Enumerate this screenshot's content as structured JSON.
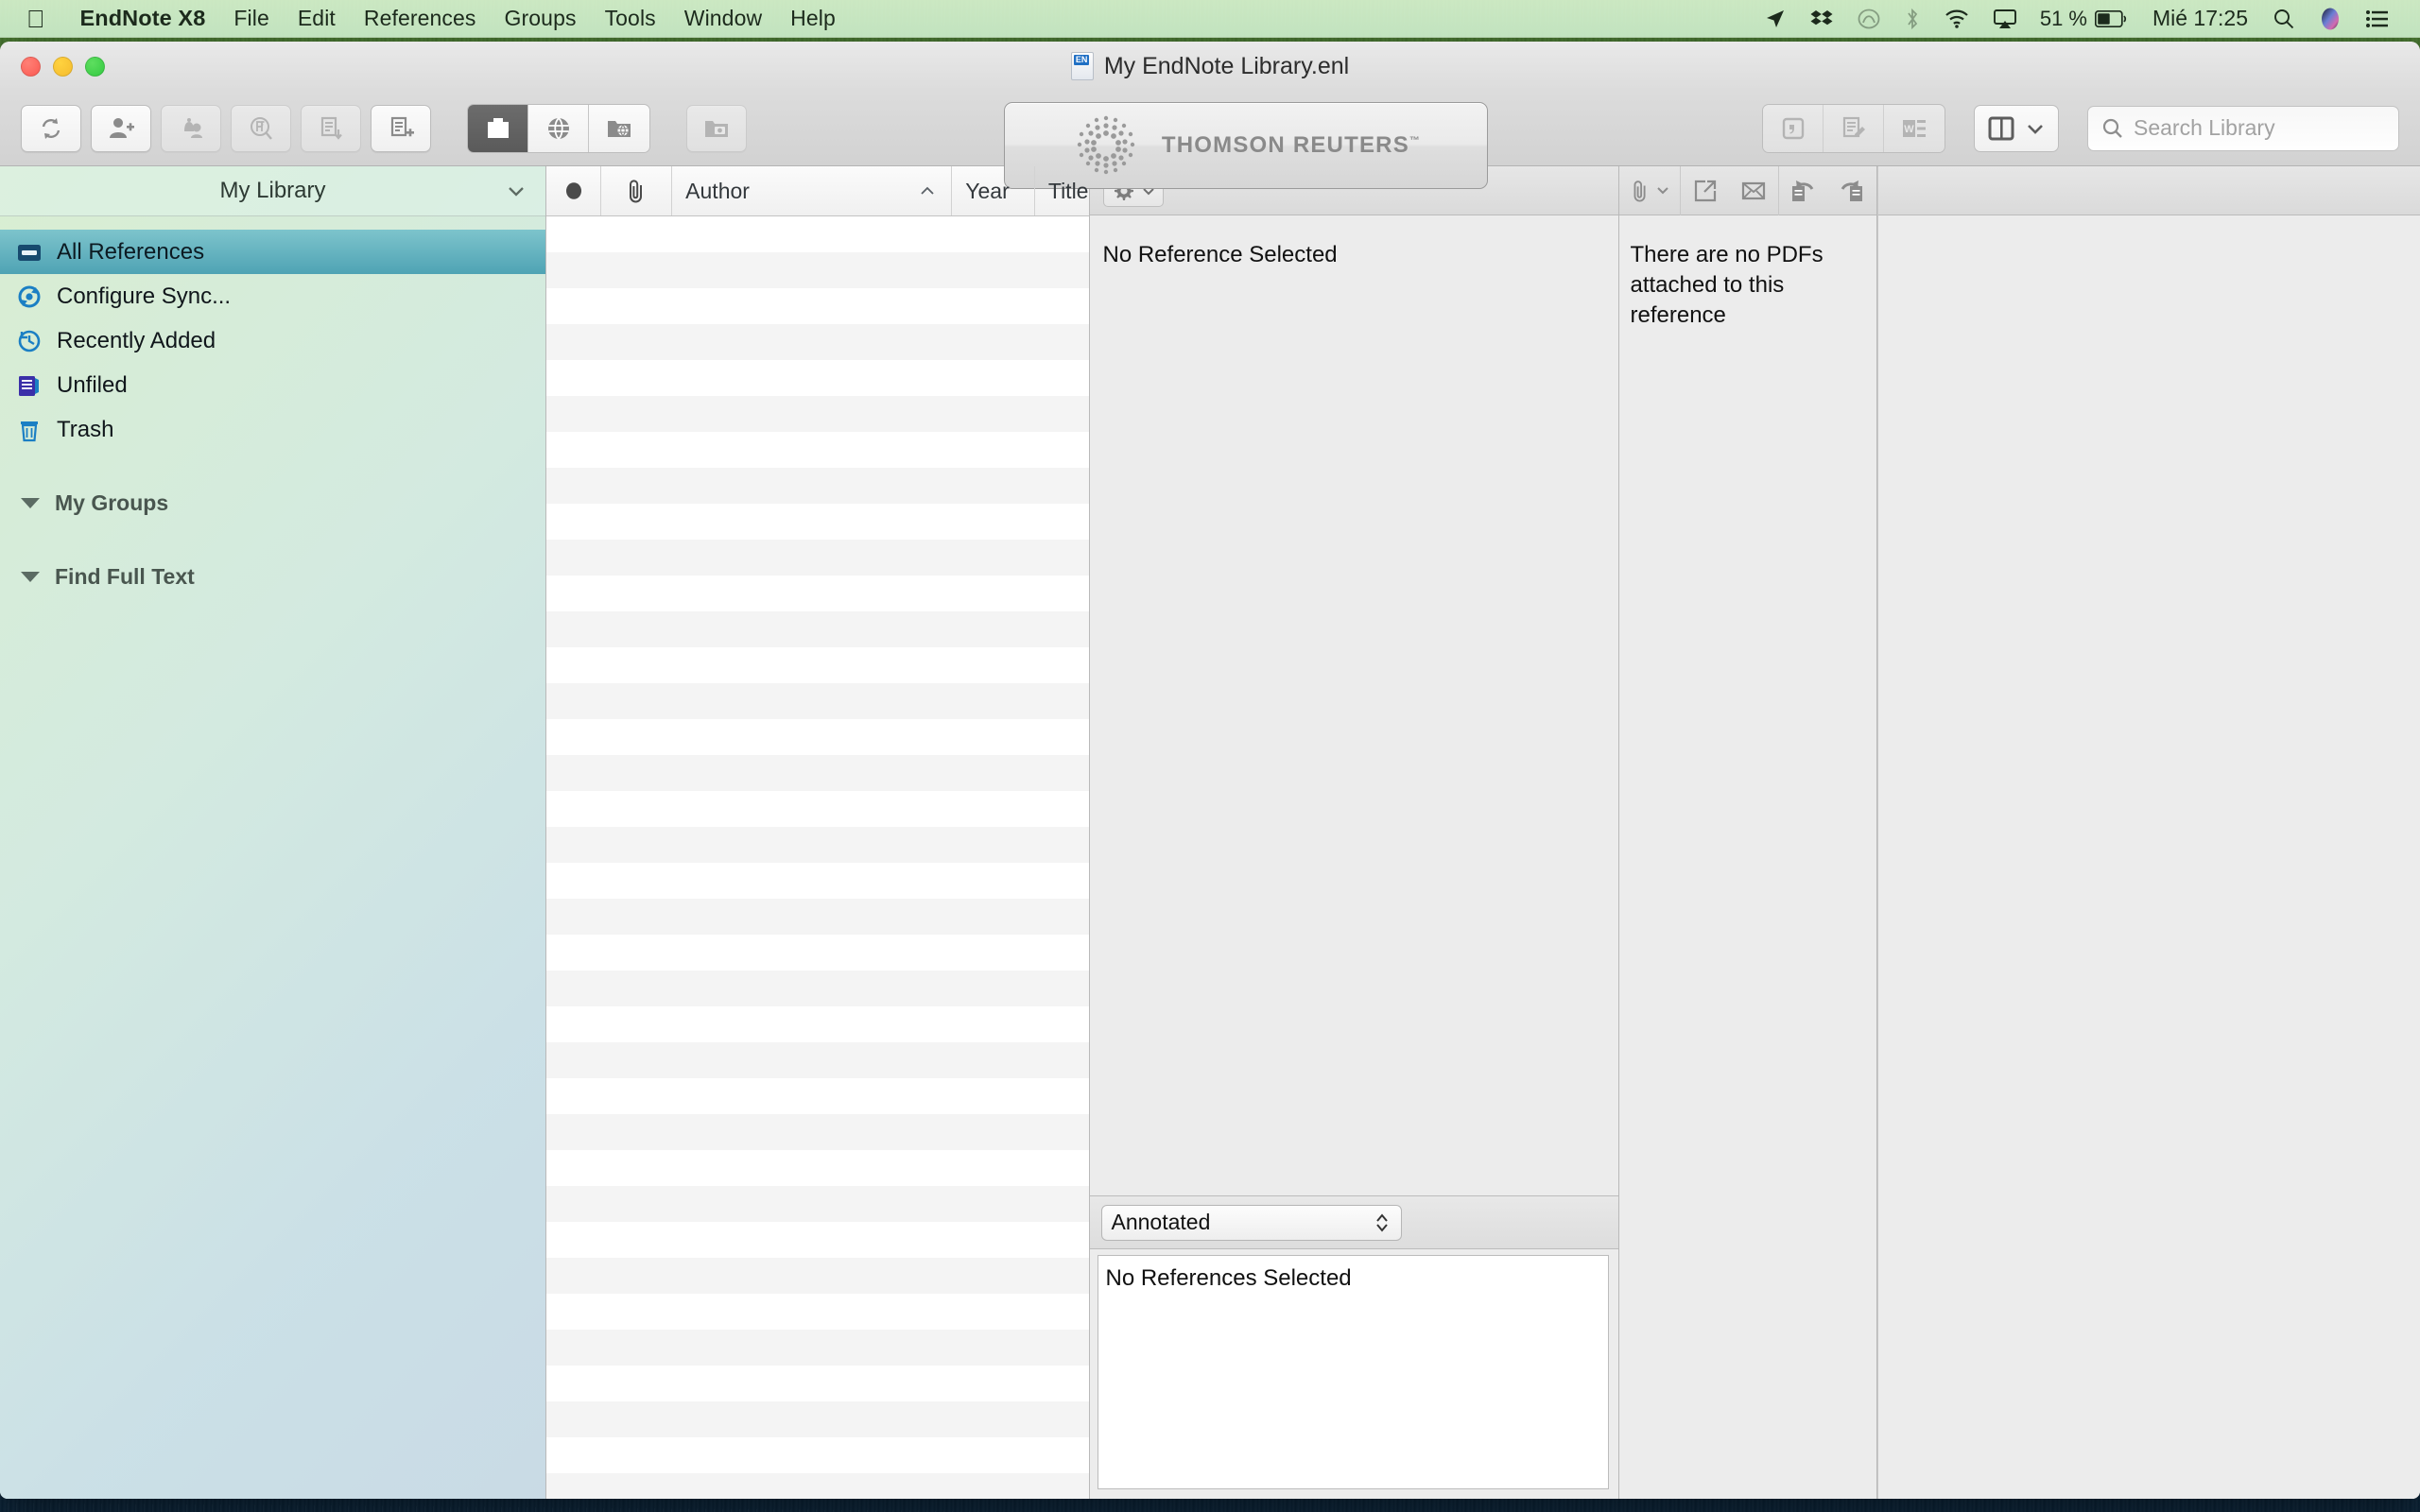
{
  "menubar": {
    "apple_icon": "apple-logo-icon",
    "items": [
      {
        "label": "EndNote X8",
        "bold": true
      },
      {
        "label": "File"
      },
      {
        "label": "Edit"
      },
      {
        "label": "References"
      },
      {
        "label": "Groups"
      },
      {
        "label": "Tools"
      },
      {
        "label": "Window"
      },
      {
        "label": "Help"
      }
    ],
    "status": {
      "icons": [
        "location-arrow-icon",
        "dropbox-icon",
        "creative-cloud-icon",
        "bluetooth-icon",
        "wifi-icon",
        "airplay-icon"
      ],
      "battery_percent": "51 %",
      "clock": "Mié 17:25",
      "trailing_icons": [
        "spotlight-search-icon",
        "siri-icon",
        "notification-center-icon"
      ]
    }
  },
  "window": {
    "title": "My EndNote Library.enl",
    "doc_icon": "endnote-document-icon"
  },
  "toolbar": {
    "buttons": [
      {
        "name": "sync-button",
        "icon": "sync-icon",
        "disabled": false
      },
      {
        "name": "share-library-button",
        "icon": "person-add-icon",
        "disabled": false
      },
      {
        "name": "activity-feed-button",
        "icon": "bell-person-icon",
        "disabled": true
      },
      {
        "name": "find-full-text-button",
        "icon": "pdf-search-icon",
        "disabled": true
      },
      {
        "name": "import-button",
        "icon": "document-import-icon",
        "disabled": true
      },
      {
        "name": "new-reference-button",
        "icon": "document-plus-icon",
        "disabled": false
      }
    ],
    "segmented": [
      {
        "name": "local-library-mode-button",
        "icon": "local-library-icon",
        "active": true
      },
      {
        "name": "online-search-mode-button",
        "icon": "globe-icon",
        "active": false
      },
      {
        "name": "integrated-mode-button",
        "icon": "folder-globe-icon",
        "active": false
      }
    ],
    "trailing_button": {
      "name": "sync-status-button",
      "icon": "folder-sync-icon",
      "disabled": true
    },
    "brand": {
      "name": "thomson-reuters-logo",
      "text": "THOMSON REUTERS",
      "trademark": "™"
    },
    "right_buttons": [
      {
        "name": "insert-citation-button",
        "icon": "quote-icon",
        "disabled": true
      },
      {
        "name": "format-bibliography-button",
        "icon": "document-pencil-icon",
        "disabled": true
      },
      {
        "name": "go-to-word-button",
        "icon": "microsoft-word-icon",
        "disabled": true
      }
    ],
    "view_button": {
      "name": "layout-view-button",
      "icon": "split-view-icon"
    },
    "accent_selected": "#5a5a5a"
  },
  "search": {
    "placeholder": "Search Library",
    "value": "",
    "icon": "magnifier-icon"
  },
  "sidebar": {
    "header": {
      "label": "My Library",
      "chevron": "chevron-down-icon"
    },
    "items": [
      {
        "label": "All References",
        "icon": "all-references-icon",
        "selected": true
      },
      {
        "label": "Configure Sync...",
        "icon": "configure-sync-icon",
        "selected": false
      },
      {
        "label": "Recently Added",
        "icon": "recently-added-clock-icon",
        "selected": false
      },
      {
        "label": "Unfiled",
        "icon": "unfiled-icon",
        "selected": false
      },
      {
        "label": "Trash",
        "icon": "trash-icon",
        "selected": false
      }
    ],
    "groups": [
      {
        "label": "My Groups",
        "expanded": true
      },
      {
        "label": "Find Full Text",
        "expanded": true
      }
    ],
    "selection_color": "#4fa3b4"
  },
  "reference_list": {
    "columns": [
      {
        "label": "",
        "name": "read-status-column",
        "icon": "filled-circle-icon"
      },
      {
        "label": "",
        "name": "attachment-column",
        "icon": "paperclip-icon"
      },
      {
        "label": "Author",
        "name": "author-column",
        "sorted": "ascending",
        "sort_icon": "caret-up-icon"
      },
      {
        "label": "Year",
        "name": "year-column"
      },
      {
        "label": "Title",
        "name": "title-column"
      }
    ],
    "rows": [],
    "row_count_visible": 36
  },
  "reference_panel": {
    "gear_button": {
      "name": "reference-settings-button",
      "icon": "gear-icon",
      "chevron": "chevron-down-icon"
    },
    "empty_message": "No Reference Selected",
    "style_popup": {
      "value": "Annotated",
      "name": "output-style-popup"
    },
    "preview_message": "No References Selected"
  },
  "pdf_panel": {
    "toolbar_icons": [
      {
        "name": "attach-file-button",
        "icon": "paperclip-icon",
        "chevron": "chevron-down-icon"
      },
      {
        "name": "open-pdf-external-button",
        "icon": "open-external-icon"
      },
      {
        "name": "email-pdf-button",
        "icon": "envelope-icon"
      },
      {
        "name": "rotate-left-button",
        "icon": "rotate-left-icon"
      },
      {
        "name": "rotate-right-button",
        "icon": "rotate-right-icon"
      }
    ],
    "empty_message": "There are no PDFs attached to this reference"
  }
}
